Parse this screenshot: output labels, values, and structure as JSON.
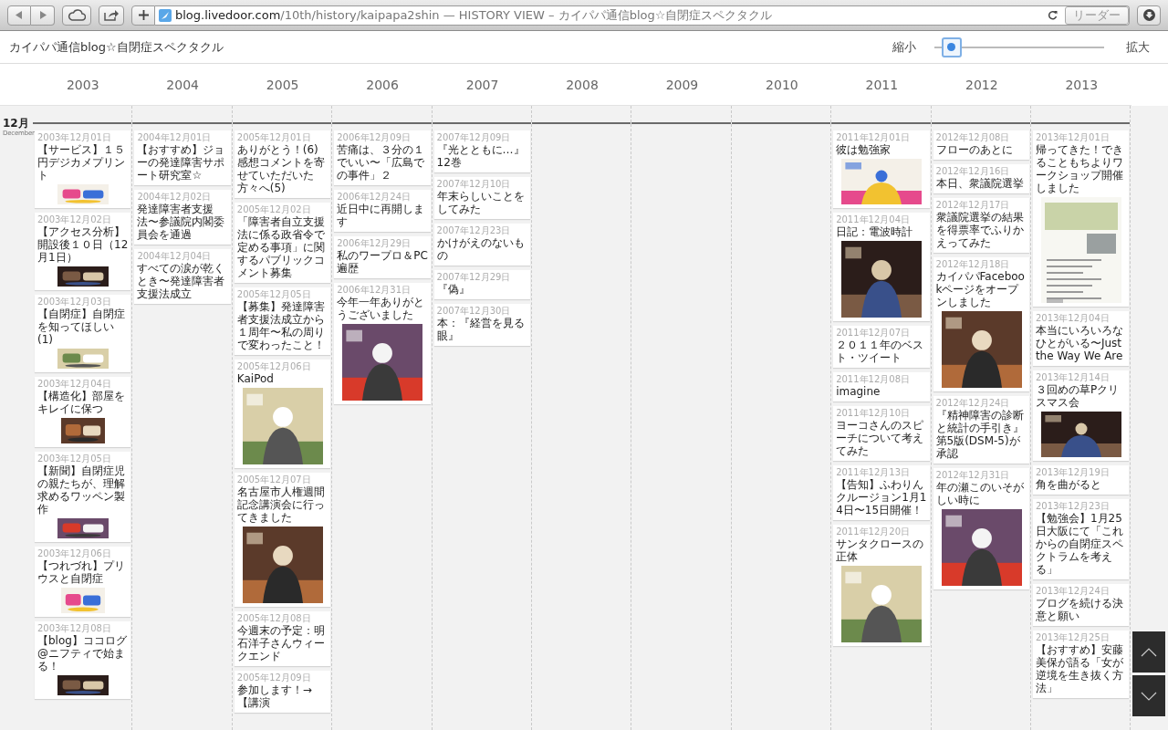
{
  "browser": {
    "url_host": "blog.livedoor.com",
    "url_rest": "/10th/history/kaipapa2shin — HISTORY VIEW – カイパパ通信blog☆自閉症スペクタクル",
    "reader": {
      "label": "リーダー",
      "disabled": true
    }
  },
  "header": {
    "title": "カイパパ通信blog☆自閉症スペクタクル",
    "zoom": {
      "min_label": "縮小",
      "max_label": "拡大",
      "level": 0.1
    }
  },
  "month": {
    "label": "12月",
    "sublabel": "December"
  },
  "years": [
    {
      "label": "2003",
      "posts": [
        {
          "kind": "banner",
          "date": "2003年12月01日",
          "title": "【サービス】１５円デジカメプリント"
        },
        {
          "kind": "banner",
          "date": "2003年12月02日",
          "title": "【アクセス分析】開設後１０日（12月1日）"
        },
        {
          "kind": "banner",
          "date": "2003年12月03日",
          "title": "【自閉症】自閉症を知ってほしい(1)"
        },
        {
          "kind": "thumb",
          "date": "2003年12月04日",
          "title": "【構造化】部屋をキレイに保つ"
        },
        {
          "kind": "banner",
          "date": "2003年12月05日",
          "title": "【新聞】自閉症児の親たちが、理解求めるワッペン製作"
        },
        {
          "kind": "thumb",
          "date": "2003年12月06日",
          "title": "【つれづれ】プリウスと自閉症"
        },
        {
          "kind": "banner",
          "date": "2003年12月08日",
          "title": "【blog】ココログ@ニフティで始まる！"
        }
      ]
    },
    {
      "label": "2004",
      "posts": [
        {
          "kind": "text",
          "date": "2004年12月01日",
          "title": "【おすすめ】ジョーの発達障害サポート研究室☆"
        },
        {
          "kind": "text",
          "date": "2004年12月02日",
          "title": "発達障害者支援法〜参議院内閣委員会を通過"
        },
        {
          "kind": "text",
          "date": "2004年12月04日",
          "title": "すべての涙が乾くとき〜発達障害者支援法成立"
        }
      ]
    },
    {
      "label": "2005",
      "posts": [
        {
          "kind": "text",
          "date": "2005年12月01日",
          "title": "ありがとう！(6)　感想コメントを寄せていただいた方々へ(5)"
        },
        {
          "kind": "text",
          "date": "2005年12月02日",
          "title": "「障害者自立支援法に係る政省令で定める事項」に関するパブリックコメント募集"
        },
        {
          "kind": "text",
          "date": "2005年12月05日",
          "title": "【募集】発達障害者支援法成立から１周年〜私の周りで変わったこと！"
        },
        {
          "kind": "tall",
          "date": "2005年12月06日",
          "title": "KaiPod"
        },
        {
          "kind": "tall",
          "date": "2005年12月07日",
          "title": "名古屋市人権週間記念講演会に行ってきました"
        },
        {
          "kind": "text",
          "date": "2005年12月08日",
          "title": "今週末の予定：明石洋子さんウィークエンド"
        },
        {
          "kind": "text",
          "date": "2005年12月09日",
          "title": "参加します！→【講演"
        }
      ]
    },
    {
      "label": "2006",
      "posts": [
        {
          "kind": "text",
          "date": "2006年12月09日",
          "title": "苦痛は、３分の１でいい〜「広島での事件」２"
        },
        {
          "kind": "text",
          "date": "2006年12月24日",
          "title": "近日中に再開します"
        },
        {
          "kind": "text",
          "date": "2006年12月29日",
          "title": "私のワープロ＆PC遍歴"
        },
        {
          "kind": "tall",
          "date": "2006年12月31日",
          "title": "今年一年ありがとうございました"
        }
      ]
    },
    {
      "label": "2007",
      "posts": [
        {
          "kind": "text",
          "date": "2007年12月09日",
          "title": "『光とともに…』12巻"
        },
        {
          "kind": "text",
          "date": "2007年12月10日",
          "title": "年末らしいことをしてみた"
        },
        {
          "kind": "text",
          "date": "2007年12月23日",
          "title": "かけがえのないもの"
        },
        {
          "kind": "text",
          "date": "2007年12月29日",
          "title": "『偽』"
        },
        {
          "kind": "text",
          "date": "2007年12月30日",
          "title": "本：『経営を見る眼』"
        }
      ]
    },
    {
      "label": "2008"
    },
    {
      "label": "2009"
    },
    {
      "label": "2010"
    },
    {
      "label": "2011",
      "posts": [
        {
          "kind": "wide",
          "date": "2011年12月01日",
          "title": "彼は勉強家"
        },
        {
          "kind": "tall",
          "date": "2011年12月04日",
          "title": "日記：電波時計"
        },
        {
          "kind": "text",
          "date": "2011年12月07日",
          "title": "２０１１年のベスト・ツイート"
        },
        {
          "kind": "text",
          "date": "2011年12月08日",
          "title": "imagine"
        },
        {
          "kind": "text",
          "date": "2011年12月10日",
          "title": "ヨーコさんのスピーチについて考えてみた"
        },
        {
          "kind": "text",
          "date": "2011年12月13日",
          "title": "【告知】ふわりんクルージョン1月14日〜15日開催！"
        },
        {
          "kind": "tall",
          "date": "2011年12月20日",
          "title": "サンタクロースの正体"
        }
      ]
    },
    {
      "label": "2012",
      "posts": [
        {
          "kind": "text",
          "date": "2012年12月08日",
          "title": "フローのあとに"
        },
        {
          "kind": "text",
          "date": "2012年12月16日",
          "title": "本日、衆議院選挙"
        },
        {
          "kind": "text",
          "date": "2012年12月17日",
          "title": "衆議院選挙の結果を得票率でふりかえってみた"
        },
        {
          "kind": "tall",
          "date": "2012年12月18日",
          "title": "カイパパFacebookページをオープンしました"
        },
        {
          "kind": "text",
          "date": "2012年12月24日",
          "title": "『精神障害の診断と統計の手引き』第5版(DSM-5)が承認"
        },
        {
          "kind": "tall",
          "date": "2012年12月31日",
          "title": "年の瀬このいそがしい時に"
        }
      ]
    },
    {
      "label": "2013",
      "posts": [
        {
          "kind": "flyer",
          "date": "2013年12月01日",
          "title": "帰ってきた！できることもちよりワークショップ開催しました"
        },
        {
          "kind": "text",
          "date": "2013年12月04日",
          "title": "本当にいろいろなひとがいる〜Just the Way We Are"
        },
        {
          "kind": "wide",
          "date": "2013年12月14日",
          "title": "３回めの草Pクリスマス会"
        },
        {
          "kind": "text",
          "date": "2013年12月19日",
          "title": "角を曲がると"
        },
        {
          "kind": "text",
          "date": "2013年12月23日",
          "title": "【勉強会】1月25日大阪にて「これからの自閉症スペクトラムを考える」"
        },
        {
          "kind": "text",
          "date": "2013年12月24日",
          "title": "ブログを続ける決意と願い"
        },
        {
          "kind": "text",
          "date": "2013年12月25日",
          "title": "【おすすめ】安藤美保が語る「女が逆境を生き抜く方法」"
        }
      ]
    }
  ]
}
